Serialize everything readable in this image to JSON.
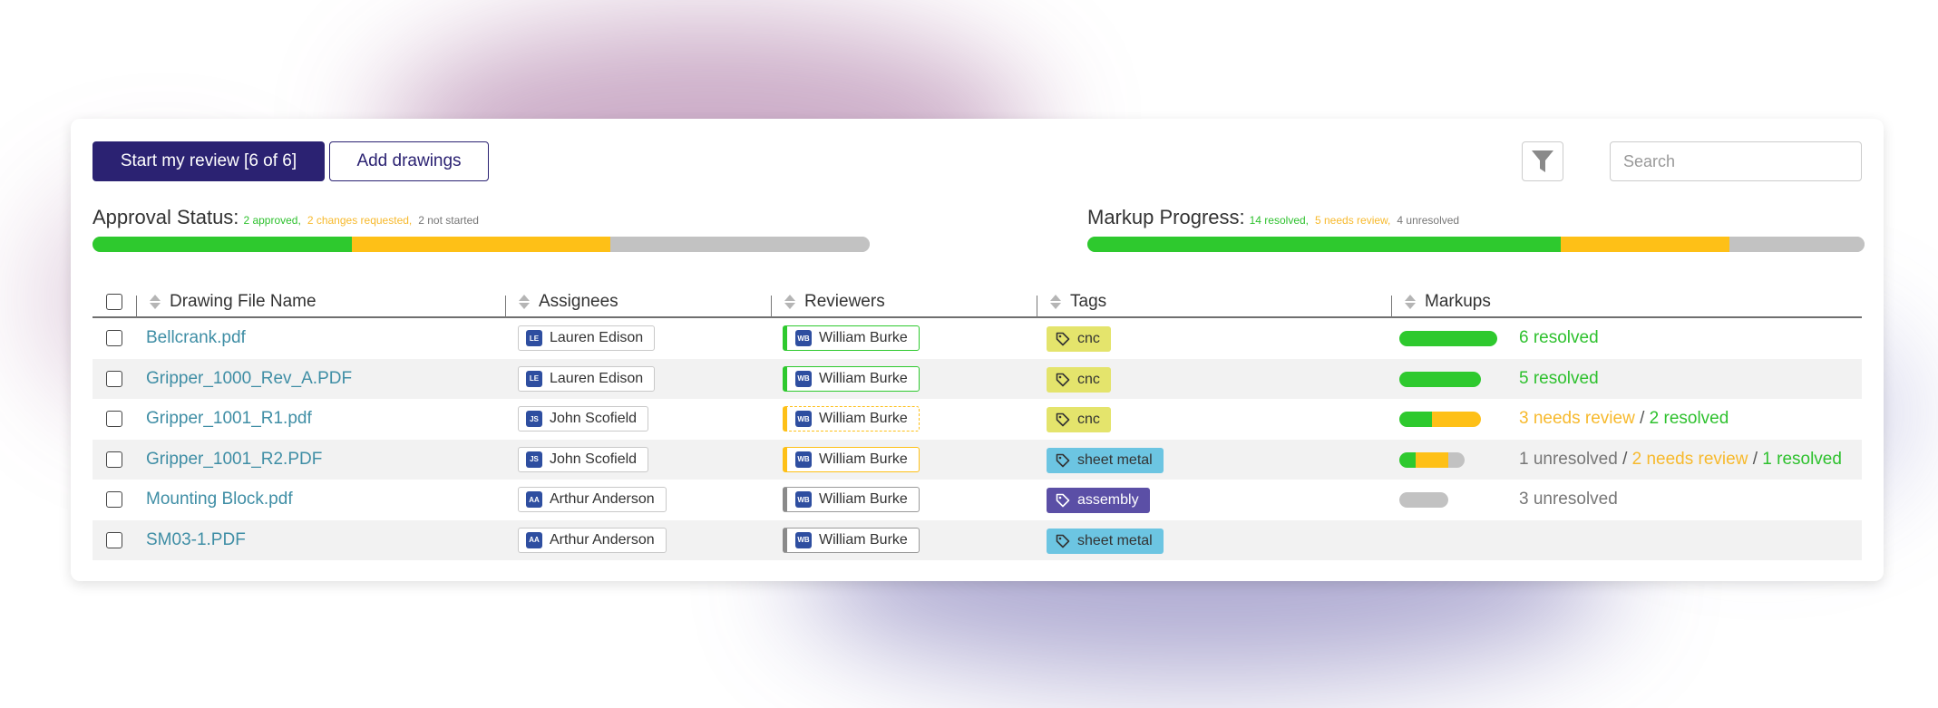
{
  "toolbar": {
    "start_review_label": "Start my review [6 of 6]",
    "add_drawings_label": "Add drawings",
    "search_placeholder": "Search"
  },
  "approval_status": {
    "title": "Approval Status:",
    "approved_text": "2 approved,",
    "changes_text": "2 changes requested,",
    "not_started_text": "2 not started",
    "approved": 2,
    "changes_requested": 2,
    "not_started": 2
  },
  "markup_progress": {
    "title": "Markup Progress:",
    "resolved_text": "14 resolved,",
    "needs_review_text": "5 needs review,",
    "unresolved_text": "4 unresolved",
    "resolved": 14,
    "needs_review": 5,
    "unresolved": 4
  },
  "table": {
    "headers": {
      "name": "Drawing File Name",
      "assignees": "Assignees",
      "reviewers": "Reviewers",
      "tags": "Tags",
      "markups": "Markups"
    },
    "rows": [
      {
        "name": "Bellcrank.pdf",
        "assignee": {
          "initials": "LE",
          "name": "Lauren Edison"
        },
        "reviewer": {
          "initials": "WB",
          "name": "William Burke",
          "status": "approved"
        },
        "tag": {
          "label": "cnc",
          "kind": "cnc"
        },
        "markups": {
          "unresolved": 0,
          "needs_review": 0,
          "resolved": 6
        },
        "markup_text": [
          {
            "text": "6 resolved",
            "kind": "resolved"
          }
        ]
      },
      {
        "name": "Gripper_1000_Rev_A.PDF",
        "assignee": {
          "initials": "LE",
          "name": "Lauren Edison"
        },
        "reviewer": {
          "initials": "WB",
          "name": "William Burke",
          "status": "approved"
        },
        "tag": {
          "label": "cnc",
          "kind": "cnc"
        },
        "markups": {
          "unresolved": 0,
          "needs_review": 0,
          "resolved": 5
        },
        "markup_text": [
          {
            "text": "5 resolved",
            "kind": "resolved"
          }
        ]
      },
      {
        "name": "Gripper_1001_R1.pdf",
        "assignee": {
          "initials": "JS",
          "name": "John Scofield"
        },
        "reviewer": {
          "initials": "WB",
          "name": "William Burke",
          "status": "inprogress"
        },
        "tag": {
          "label": "cnc",
          "kind": "cnc"
        },
        "markups": {
          "unresolved": 0,
          "needs_review": 3,
          "resolved": 2
        },
        "markup_text": [
          {
            "text": "3 needs review",
            "kind": "needs_review"
          },
          {
            "text": "2 resolved",
            "kind": "resolved"
          }
        ]
      },
      {
        "name": "Gripper_1001_R2.PDF",
        "assignee": {
          "initials": "JS",
          "name": "John Scofield"
        },
        "reviewer": {
          "initials": "WB",
          "name": "William Burke",
          "status": "changes"
        },
        "tag": {
          "label": "sheet metal",
          "kind": "sheet"
        },
        "markups": {
          "unresolved": 1,
          "needs_review": 2,
          "resolved": 1
        },
        "markup_text": [
          {
            "text": "1 unresolved",
            "kind": "unresolved"
          },
          {
            "text": "2 needs review",
            "kind": "needs_review"
          },
          {
            "text": "1 resolved",
            "kind": "resolved"
          }
        ]
      },
      {
        "name": "Mounting Block.pdf",
        "assignee": {
          "initials": "AA",
          "name": "Arthur Anderson"
        },
        "reviewer": {
          "initials": "WB",
          "name": "William Burke",
          "status": "notstarted"
        },
        "tag": {
          "label": "assembly",
          "kind": "assembly"
        },
        "markups": {
          "unresolved": 3,
          "needs_review": 0,
          "resolved": 0
        },
        "markup_text": [
          {
            "text": "3 unresolved",
            "kind": "unresolved"
          }
        ]
      },
      {
        "name": "SM03-1.PDF",
        "assignee": {
          "initials": "AA",
          "name": "Arthur Anderson"
        },
        "reviewer": {
          "initials": "WB",
          "name": "William Burke",
          "status": "notstarted"
        },
        "tag": {
          "label": "sheet metal",
          "kind": "sheet"
        },
        "markups": {
          "unresolved": 0,
          "needs_review": 0,
          "resolved": 0
        },
        "markup_text": []
      }
    ]
  },
  "colors": {
    "primary": "#2b2272",
    "resolved": "#2ec92e",
    "needs_review": "#fec017",
    "unresolved": "#c2c2c2",
    "link": "#3f8ea5"
  },
  "icons": {
    "filter": "filter-icon",
    "tag": "tag-icon",
    "sort": "sort-icon"
  }
}
